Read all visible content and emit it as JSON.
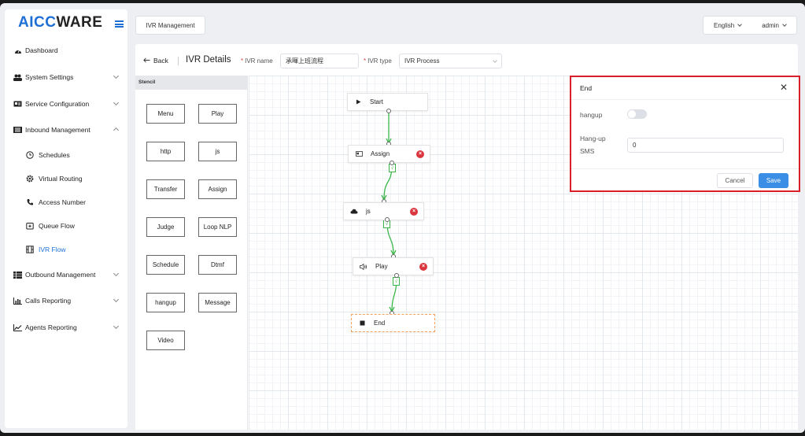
{
  "app": {
    "logo_text_1": "AICC",
    "logo_text_2": "WARE"
  },
  "colors": {
    "accent": "#1d6fd6",
    "edge": "#3bb54a",
    "delete": "#d9363e",
    "highlight": "#d9202a",
    "primary_button": "#3a8ee6"
  },
  "sidebar": {
    "dashboard": "Dashboard",
    "system_settings": "System Settings",
    "service_configuration": "Service Configuration",
    "inbound_management": "Inbound Management",
    "schedules": "Schedules",
    "virtual_routing": "Virtual Routing",
    "access_number": "Access Number",
    "queue_flow": "Queue Flow",
    "ivr_flow": "IVR Flow",
    "outbound_management": "Outbound Management",
    "calls_reporting": "Calls Reporting",
    "agents_reporting": "Agents Reporting"
  },
  "topbar": {
    "tab_label": "IVR Management",
    "language": "English",
    "user": "admin"
  },
  "toolbar": {
    "back_label": "Back",
    "page_title": "IVR Details",
    "ivr_name_label": "IVR name",
    "ivr_name_value": "承暉上班流程",
    "ivr_type_label": "IVR type",
    "ivr_type_value": "IVR Process"
  },
  "stencil": {
    "header": "Stencil",
    "items": [
      "Menu",
      "Play",
      "http",
      "js",
      "Transfer",
      "Assign",
      "Judge",
      "Loop NLP",
      "Schedule",
      "Dtmf",
      "hangup",
      "Message",
      "Video"
    ]
  },
  "flow": {
    "nodes": [
      "Start",
      "Assign",
      "js",
      "Play",
      "End"
    ],
    "edge_label": "√"
  },
  "dialog": {
    "title": "End",
    "hangup_label": "hangup",
    "hangup_enabled": false,
    "sms_label_1": "Hang-up",
    "sms_label_2": "SMS",
    "sms_value": "0",
    "cancel_label": "Cancel",
    "save_label": "Save"
  }
}
